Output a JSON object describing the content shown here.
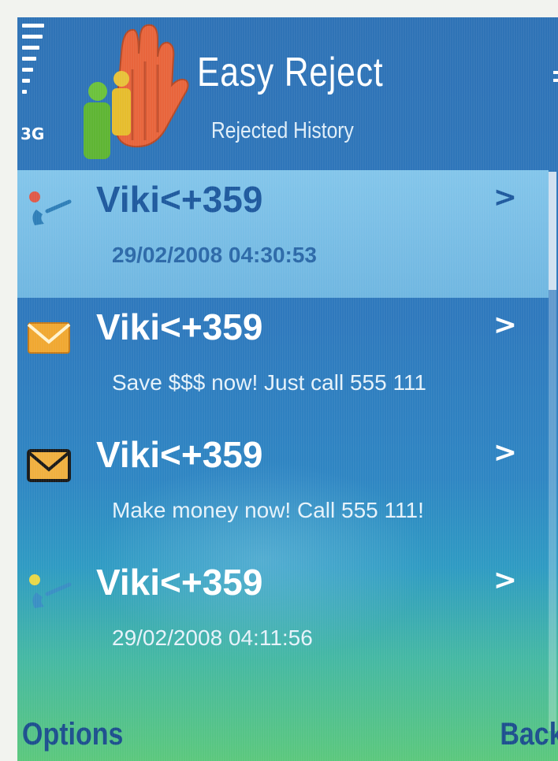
{
  "status_bar": {
    "network_type": "3G",
    "signal_icon": "signal-strength-icon",
    "battery_icon": "battery-icon"
  },
  "header": {
    "logo_icon": "raised-hand-people-icon",
    "title": "Easy Reject",
    "subtitle": "Rejected History"
  },
  "list": {
    "items": [
      {
        "type": "call",
        "icon": "rejected-call-icon",
        "name": "Viki<+359",
        "arrow": ">",
        "detail": "29/02/2008 04:30:53",
        "selected": true
      },
      {
        "type": "sms",
        "icon": "envelope-icon",
        "name": "Viki<+359",
        "arrow": ">",
        "detail": "Save $$$ now! Just call 555 111",
        "selected": false
      },
      {
        "type": "sms",
        "icon": "envelope-icon",
        "name": "Viki<+359",
        "arrow": ">",
        "detail": "Make money now! Call 555 111!",
        "selected": false
      },
      {
        "type": "call",
        "icon": "rejected-call-icon",
        "name": "Viki<+359",
        "arrow": ">",
        "detail": "29/02/2008 04:11:56",
        "selected": false
      }
    ]
  },
  "softkeys": {
    "left": "Options",
    "right": "Back"
  },
  "colors": {
    "background_top": "#2f73b6",
    "background_bottom": "#5cc87d",
    "highlight": "#96d7f5",
    "selected_text": "#1f5a9e",
    "softkey_text": "#1d4f8e"
  }
}
